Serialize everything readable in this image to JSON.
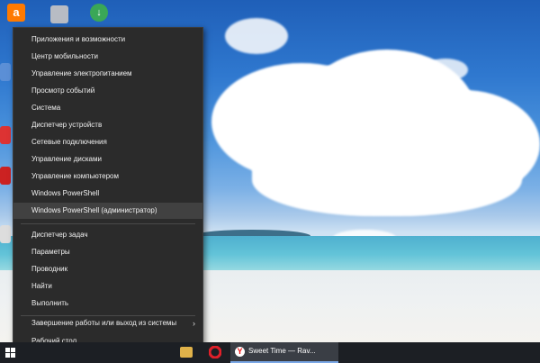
{
  "desktop": {
    "icons": [
      {
        "name": "avast-icon",
        "color": "#ff7a00"
      },
      {
        "name": "installer-icon",
        "color": "#c0c0c0"
      },
      {
        "name": "download-icon",
        "color": "#3aa757"
      }
    ]
  },
  "context_menu": {
    "group1": [
      "Приложения и возможности",
      "Центр мобильности",
      "Управление электропитанием",
      "Просмотр событий",
      "Система",
      "Диспетчер устройств",
      "Сетевые подключения",
      "Управление дисками",
      "Управление компьютером",
      "Windows PowerShell",
      "Windows PowerShell (администратор)"
    ],
    "group2": [
      "Диспетчер задач",
      "Параметры",
      "Проводник",
      "Найти",
      "Выполнить"
    ],
    "group3": [
      "Завершение работы или выход из системы",
      "Рабочий стол"
    ],
    "highlighted_item": "Windows PowerShell (администратор)",
    "submenu_arrow": "›"
  },
  "taskbar": {
    "active_app_label": "Sweet Time — Rav...",
    "accent": "#7aa7e6"
  }
}
